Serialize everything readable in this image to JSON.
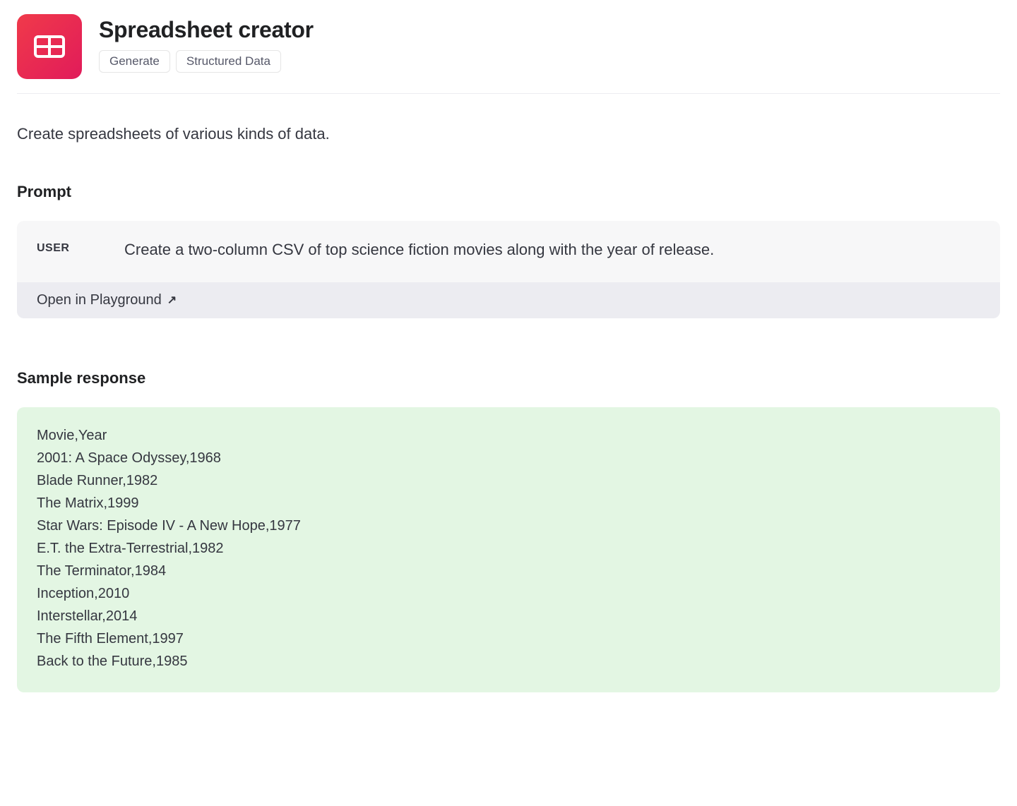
{
  "header": {
    "title": "Spreadsheet creator",
    "tags": [
      "Generate",
      "Structured Data"
    ]
  },
  "description": "Create spreadsheets of various kinds of data.",
  "prompt": {
    "heading": "Prompt",
    "role": "USER",
    "text": "Create a two-column CSV of top science fiction movies along with the year of release.",
    "open_label": "Open in Playground"
  },
  "response": {
    "heading": "Sample response",
    "lines": [
      "Movie,Year",
      "2001: A Space Odyssey,1968",
      "Blade Runner,1982",
      "The Matrix,1999",
      "Star Wars: Episode IV - A New Hope,1977",
      "E.T. the Extra-Terrestrial,1982",
      "The Terminator,1984",
      "Inception,2010",
      "Interstellar,2014",
      "The Fifth Element,1997",
      "Back to the Future,1985"
    ]
  }
}
